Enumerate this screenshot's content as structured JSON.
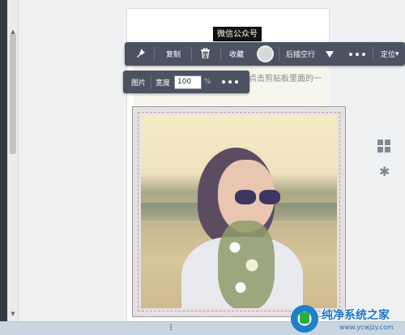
{
  "editor": {
    "article_title": "微信公众号",
    "text_line1": "点击剪贴板里面的一",
    "text_line2": "————"
  },
  "toolbar_main": {
    "pin_icon": "pin-icon",
    "copy_label": "复制",
    "delete_icon": "trash-icon",
    "favorite_label": "收藏",
    "insert_after_label": "后插空行",
    "more_icon": "more-dots-icon",
    "position_label": "定位",
    "position_caret": "▾"
  },
  "toolbar_image": {
    "image_label": "图片",
    "width_label": "宽度",
    "width_value": "100",
    "width_unit": "%",
    "more_icon": "more-dots-icon"
  },
  "scrollbar": {
    "up_arrow": "▲",
    "down_arrow": "▼"
  },
  "side_icons": {
    "grid": "grid-icon",
    "gear": "gear-icon",
    "gear_glyph": "✱"
  },
  "watermark": {
    "title": "纯净系统之家",
    "url": "www.ycwjzy.com"
  },
  "colors": {
    "toolbar_bg": "#4b5262",
    "sidebar_dark": "#333b44",
    "watermark_blue": "#1d74c5"
  }
}
